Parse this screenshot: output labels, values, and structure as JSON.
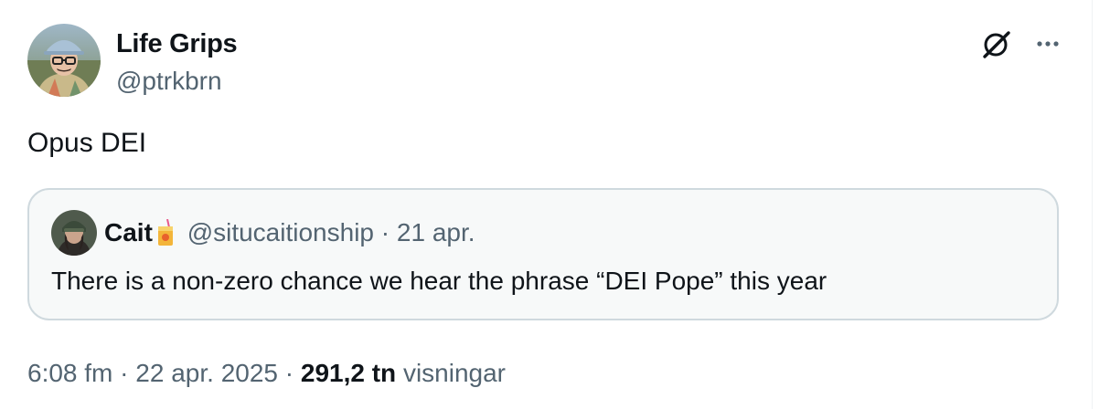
{
  "author": {
    "display_name": "Life Grips",
    "handle": "@ptrkbrn"
  },
  "icons": {
    "grok": "grok-icon",
    "more": "more-icon"
  },
  "tweet": {
    "text": "Opus DEI"
  },
  "quoted_tweet": {
    "display_name": "Cait",
    "emoji": "juice-box-emoji",
    "handle": "@situcaitionship",
    "separator": "·",
    "date": "21 apr.",
    "text": "There is a non-zero chance we hear the phrase “DEI Pope” this year"
  },
  "meta": {
    "time": "6:08 fm",
    "separator": "·",
    "date": "22 apr. 2025",
    "views_count": "291,2 tn",
    "views_label": "visningar"
  },
  "colors": {
    "text_primary": "#0f1419",
    "text_secondary": "#536471",
    "card_border": "#cfd9de",
    "card_background": "#f7f9f9"
  }
}
